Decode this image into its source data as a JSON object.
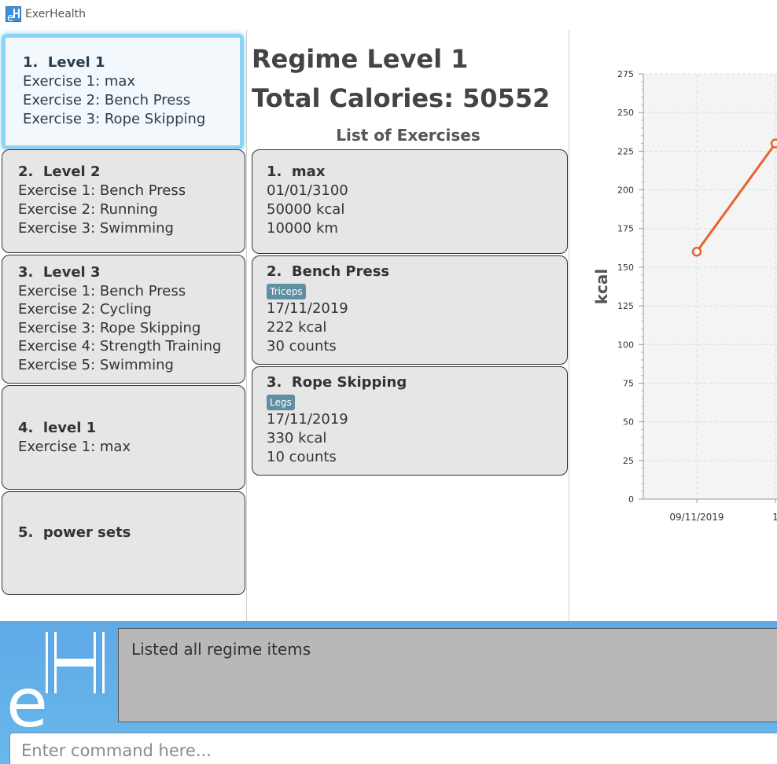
{
  "window": {
    "title": "ExerHealth"
  },
  "regimes": [
    {
      "index": "1.",
      "name": "Level 1",
      "exercises": [
        "Exercise 1: max",
        "Exercise 2: Bench Press",
        "Exercise 3: Rope Skipping"
      ],
      "selected": true
    },
    {
      "index": "2.",
      "name": "Level 2",
      "exercises": [
        "Exercise 1: Bench Press",
        "Exercise 2: Running",
        "Exercise 3: Swimming"
      ],
      "selected": false
    },
    {
      "index": "3.",
      "name": "Level 3",
      "exercises": [
        "Exercise 1: Bench Press",
        "Exercise 2: Cycling",
        "Exercise 3: Rope Skipping",
        "Exercise 4: Strength Training",
        "Exercise 5: Swimming"
      ],
      "selected": false
    },
    {
      "index": "4.",
      "name": "level 1",
      "exercises": [
        "Exercise 1: max"
      ],
      "selected": false
    },
    {
      "index": "5.",
      "name": "power sets",
      "exercises": [],
      "selected": false
    }
  ],
  "detail": {
    "regime_title": "Regime Level 1",
    "total_calories": "Total Calories: 50552",
    "list_heading": "List of Exercises",
    "exercises": [
      {
        "index": "1.",
        "name": "max",
        "tag": "",
        "date": "01/01/3100",
        "calories": "50000 kcal",
        "quantity": "10000 km"
      },
      {
        "index": "2.",
        "name": "Bench Press",
        "tag": "Triceps",
        "date": "17/11/2019",
        "calories": "222 kcal",
        "quantity": "30 counts"
      },
      {
        "index": "3.",
        "name": "Rope Skipping",
        "tag": "Legs",
        "date": "17/11/2019",
        "calories": "330 kcal",
        "quantity": "10 counts"
      }
    ]
  },
  "chart_data": {
    "type": "line",
    "title": "",
    "ylabel": "kcal",
    "xlabel": "",
    "ylim": [
      0,
      275
    ],
    "yticks": [
      0,
      25,
      50,
      75,
      100,
      125,
      150,
      175,
      200,
      225,
      250,
      275
    ],
    "x": [
      "09/11/2019",
      "1"
    ],
    "visible_x_tick_labels": [
      "09/11/2019",
      "1"
    ],
    "series": [
      {
        "values": [
          160,
          230
        ],
        "color": "#e8632b"
      }
    ],
    "grid": true
  },
  "result": {
    "text": "Listed all regime items"
  },
  "command": {
    "placeholder": "Enter command here..."
  },
  "colors": {
    "selected_border": "#8ed3f5",
    "tag_bg": "#5f8fa3",
    "bottom_bg": "#5fa9e6",
    "series_line": "#e8632b"
  }
}
